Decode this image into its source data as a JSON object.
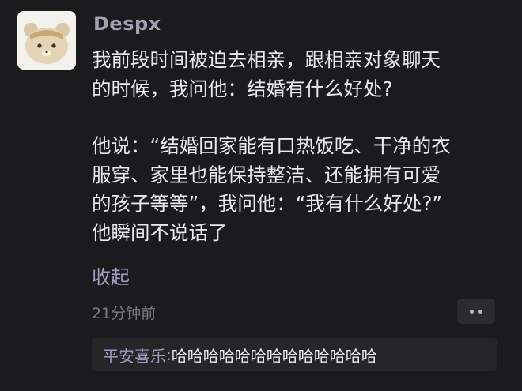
{
  "post": {
    "username": "Despx",
    "paragraphs": [
      "我前段时间被迫去相亲，跟相亲对象聊天\n的时候，我问他：结婚有什么好处?",
      "他说：“结婚回家能有口热饭吃、干净的衣\n服穿、家里也能保持整洁、还能拥有可爱\n的孩子等等”，我问他：“我有什么好处?”\n他瞬间不说话了"
    ],
    "collapse_label": "收起",
    "timestamp": "21分钟前",
    "more_icon": "more-dots-icon"
  },
  "reply": {
    "author": "平安喜乐",
    "separator": ":",
    "text": "哈哈哈哈哈哈哈哈哈哈哈哈哈"
  },
  "colors": {
    "background": "#1b1b1d",
    "username": "#9fa2b3",
    "body_text": "#e9e9ec",
    "link": "#9aa0c4",
    "muted": "#7c7d83"
  }
}
